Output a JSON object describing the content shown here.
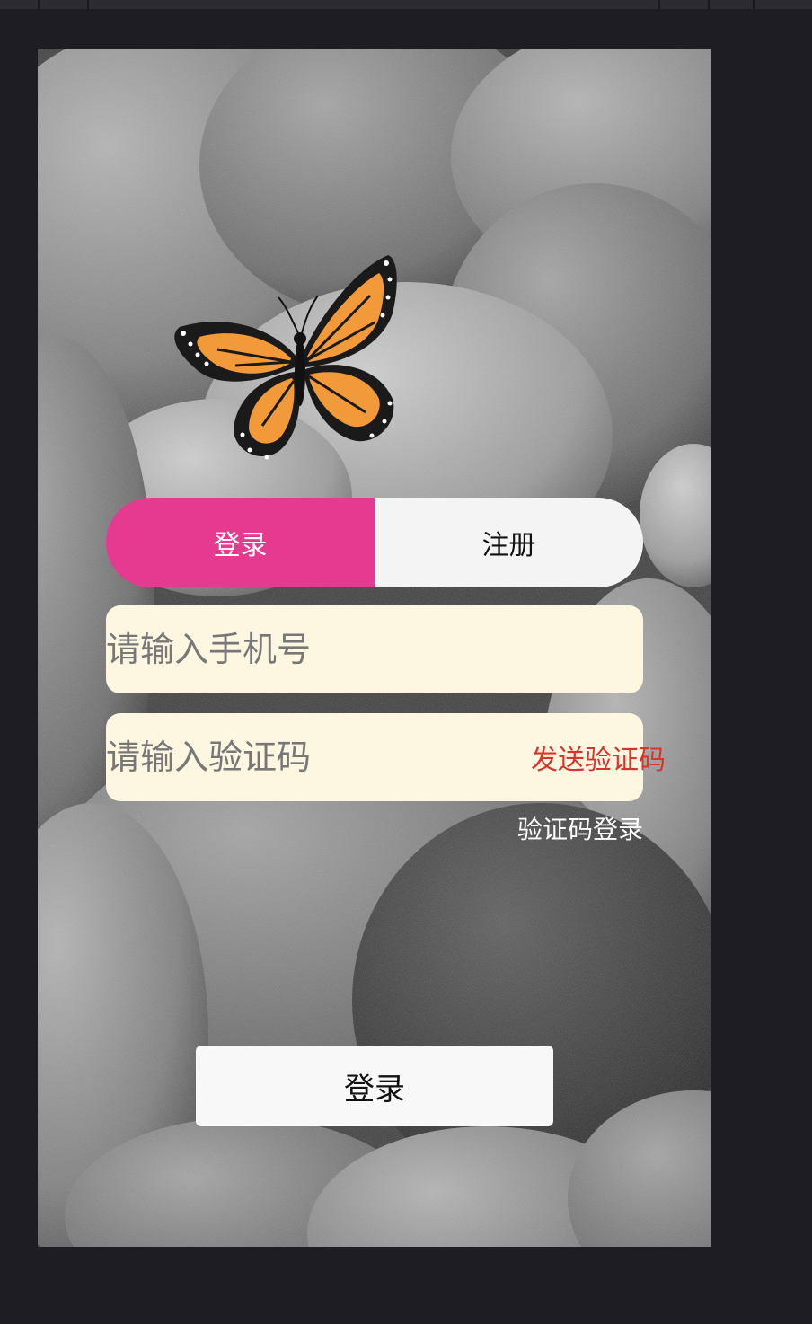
{
  "tabs": {
    "login_label": "登录",
    "register_label": "注册",
    "active": "login"
  },
  "form": {
    "phone_placeholder": "请输入手机号",
    "code_placeholder": "请输入验证码",
    "send_code_label": "发送验证码",
    "alt_login_label": "验证码登录",
    "submit_label": "登录"
  },
  "colors": {
    "tab_active": "#e63a91",
    "tab_inactive": "#f4f4f4",
    "input_bg": "#fdf6e0",
    "send_code": "#d7352a"
  },
  "icons": {
    "hero": "butterfly-icon"
  }
}
